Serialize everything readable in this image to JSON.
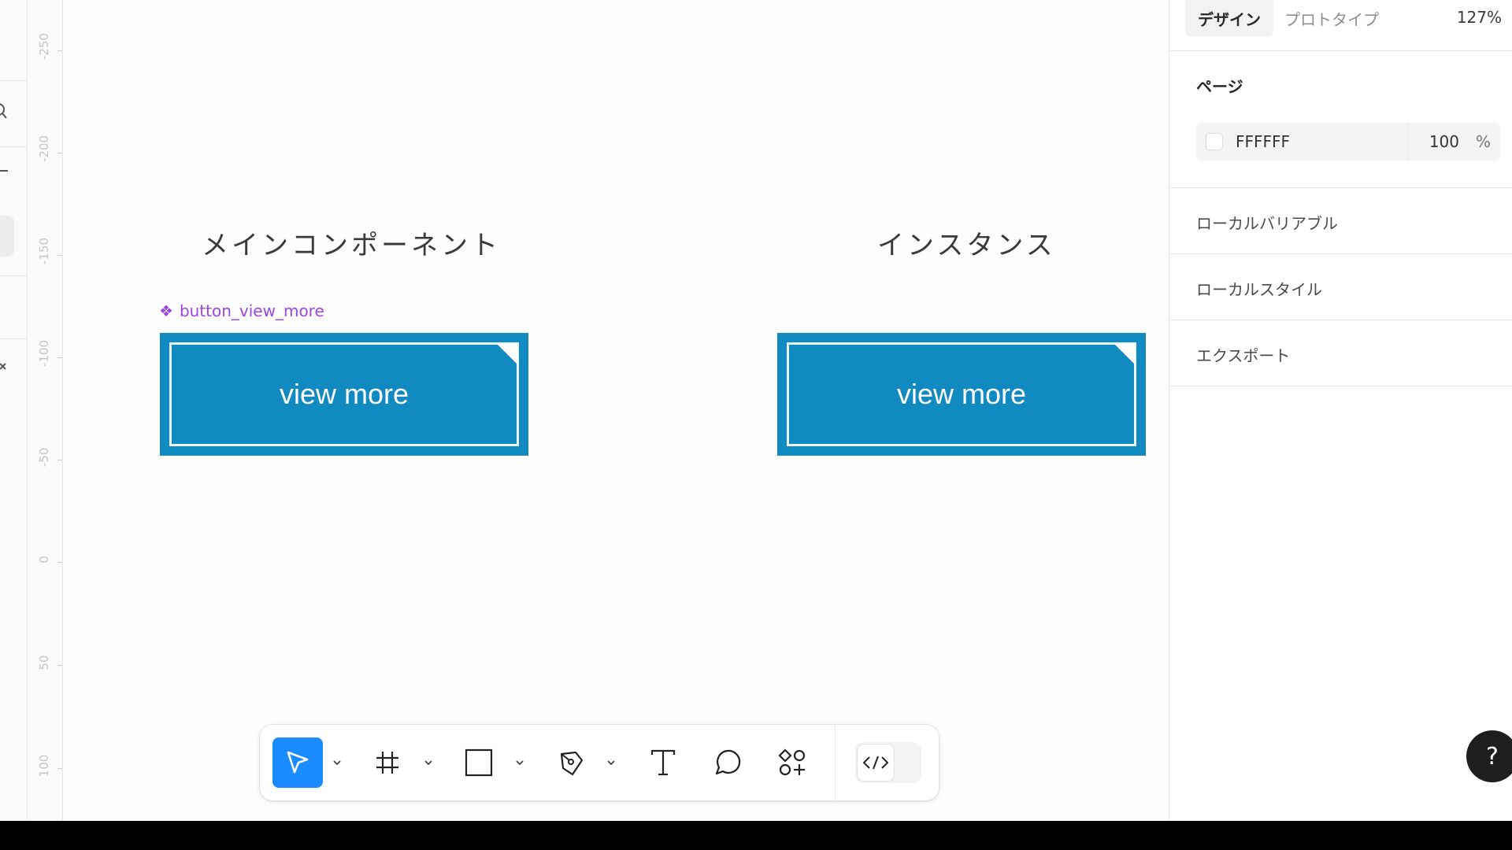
{
  "ruler": {
    "ticks": [
      "-250",
      "-200",
      "-150",
      "-100",
      "-50",
      "0",
      "50",
      "100"
    ]
  },
  "canvas": {
    "main_title": "メインコンポーネント",
    "instance_title": "インスタンス",
    "component_name": "button_view_more",
    "main_button_text": "view more",
    "instance_button_text": "view more",
    "button_fill": "#1189c1",
    "component_color": "#9b47e6"
  },
  "toolbar": {
    "tools": [
      "move-icon",
      "frame-icon",
      "rectangle-icon",
      "pen-icon",
      "text-icon",
      "comment-icon",
      "actions-icon"
    ],
    "dev_mode": "code-icon",
    "active_color": "#1a8cff"
  },
  "right_panel": {
    "tabs": {
      "design": "デザイン",
      "prototype": "プロトタイプ"
    },
    "zoom": "127%",
    "page_section": "ページ",
    "page_color": {
      "hex": "FFFFFF",
      "opacity": "100",
      "unit": "%"
    },
    "sections": [
      "ローカルバリアブル",
      "ローカルスタイル",
      "エクスポート"
    ]
  },
  "help": "?"
}
